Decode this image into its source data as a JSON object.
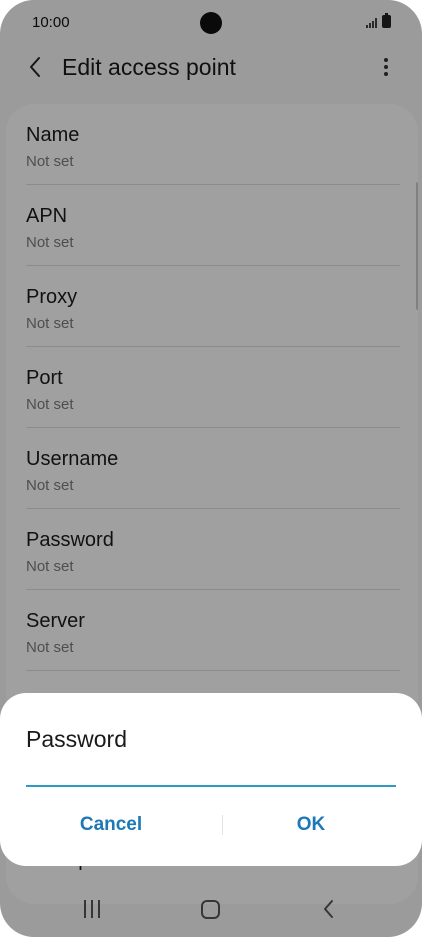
{
  "status_bar": {
    "time": "10:00"
  },
  "header": {
    "title": "Edit access point",
    "back_icon": "chevron-left-icon",
    "more_icon": "more-vertical-icon"
  },
  "settings": [
    {
      "title": "Name",
      "value": "Not set"
    },
    {
      "title": "APN",
      "value": "Not set"
    },
    {
      "title": "Proxy",
      "value": "Not set"
    },
    {
      "title": "Port",
      "value": "Not set"
    },
    {
      "title": "Username",
      "value": "Not set"
    },
    {
      "title": "Password",
      "value": "Not set"
    },
    {
      "title": "Server",
      "value": "Not set"
    }
  ],
  "peek_row": {
    "title": "MMS port"
  },
  "dialog": {
    "title": "Password",
    "input_value": "",
    "cancel_label": "Cancel",
    "ok_label": "OK",
    "accent_color": "#2e9ac6",
    "button_color": "#1c78b6"
  },
  "nav_bar": {
    "recents_icon": "recents-icon",
    "home_icon": "home-icon",
    "back_icon": "back-icon"
  }
}
